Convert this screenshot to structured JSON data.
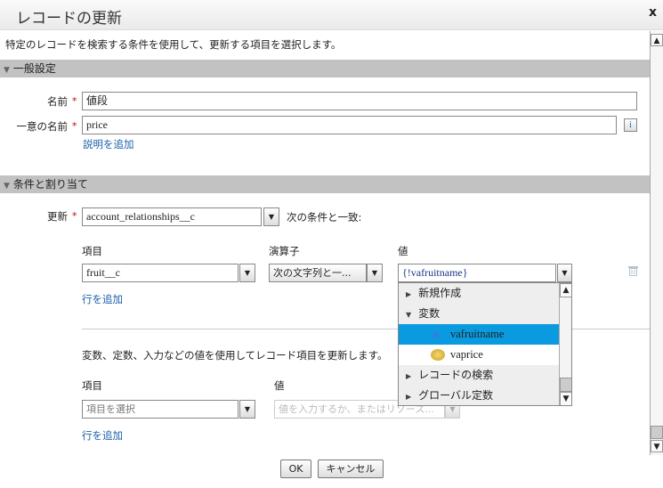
{
  "dialog": {
    "title": "レコードの更新",
    "close_label": "x",
    "description": "特定のレコードを検索する条件を使用して、更新する項目を選択します。"
  },
  "general": {
    "section_title": "一般設定",
    "name_label": "名前",
    "name_value": "値段",
    "unique_label": "一意の名前",
    "unique_value": "price",
    "info_label": "i",
    "add_description": "説明を追加"
  },
  "conditions": {
    "section_title": "条件と割り当て",
    "update_label": "更新",
    "object_value": "account_relationships__c",
    "match_text": "次の条件と一致:",
    "headers": {
      "field": "項目",
      "operator": "演算子",
      "value": "値"
    },
    "row": {
      "field": "fruit__c",
      "operator": "次の文字列と一...",
      "value": "{!vafruitname}"
    },
    "add_row": "行を追加"
  },
  "dropdown": {
    "items": [
      {
        "label": "新規作成",
        "type": "group",
        "expanded": false
      },
      {
        "label": "変数",
        "type": "group",
        "expanded": true
      },
      {
        "label": "vafruitname",
        "type": "variable",
        "icon": "text-variable-icon",
        "selected": true
      },
      {
        "label": "vaprice",
        "type": "variable",
        "icon": "coins-icon"
      },
      {
        "label": "レコードの検索",
        "type": "group",
        "expanded": false
      },
      {
        "label": "グローバル定数",
        "type": "group",
        "expanded": false
      }
    ],
    "selected_color": "#0a9ae0"
  },
  "assign": {
    "description": "変数、定数、入力などの値を使用してレコード項目を更新します。",
    "headers": {
      "field": "項目",
      "value": "値"
    },
    "field_placeholder": "項目を選択",
    "value_placeholder": "値を入力するか、またはリソース...",
    "add_row": "行を追加"
  },
  "footer": {
    "ok": "OK",
    "cancel": "キャンセル"
  }
}
